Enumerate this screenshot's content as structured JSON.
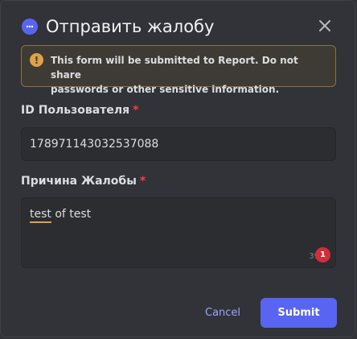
{
  "modal": {
    "title": "Отправить жалобу",
    "app_icon": "chat-bubble-icon",
    "close_icon": "close-icon"
  },
  "notice": {
    "icon": "warning-icon",
    "text_line1": "This form will be submitted to Report. Do not share",
    "text_line2": "passwords or other sensitive information.",
    "border_color": "#8f6f45",
    "icon_color": "#e0a244"
  },
  "fields": {
    "user_id": {
      "label": "ID Пользователя",
      "required_mark": "*",
      "value": "178971143032537088"
    },
    "reason": {
      "label": "Причина Жалобы",
      "required_mark": "*",
      "value_word1": "test",
      "value_rest": " of test",
      "char_counter": "39",
      "badge_count": "1"
    }
  },
  "footer": {
    "cancel_label": "Cancel",
    "submit_label": "Submit"
  },
  "colors": {
    "accent": "#5865f2",
    "required": "#f23f43",
    "badge": "#d22d39"
  }
}
